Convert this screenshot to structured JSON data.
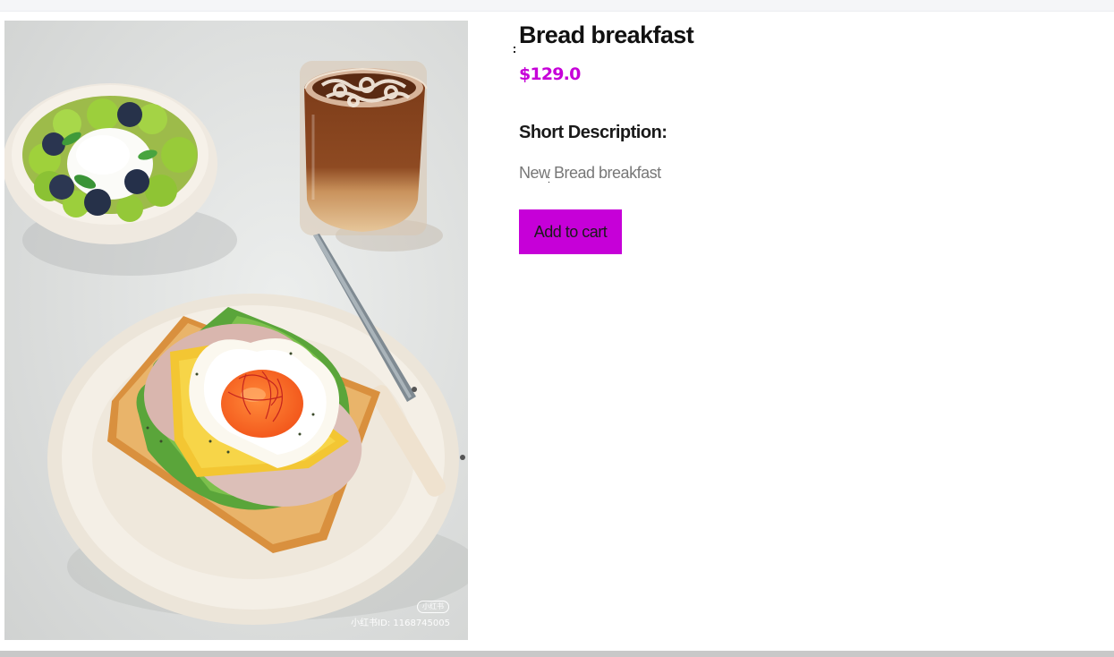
{
  "product": {
    "title": "Bread breakfast",
    "price": "$129.0",
    "short_description_heading": "Short Description:",
    "short_description": "New Bread breakfast",
    "add_to_cart_label": "Add to cart",
    "image": {
      "watermark_badge": "小红书",
      "watermark_id": "小红书ID: 1168745005"
    }
  },
  "colors": {
    "accent": "#c600d8",
    "page_bg": "#ffffff",
    "text_dark": "#111111",
    "text_muted": "#777777"
  }
}
